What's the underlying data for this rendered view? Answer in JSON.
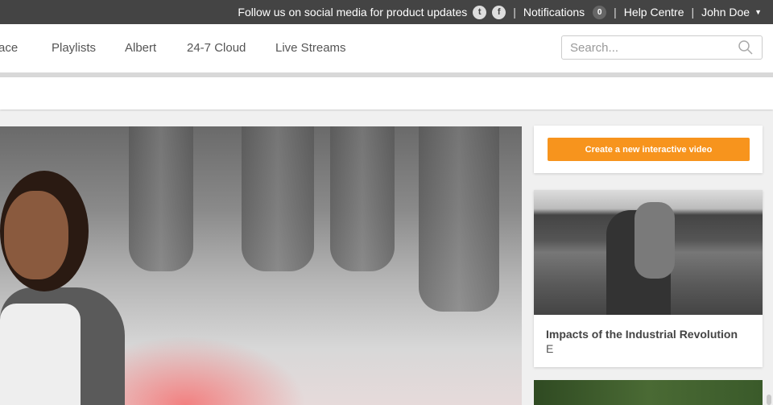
{
  "topbar": {
    "follow_text": "Follow us on social media for product updates",
    "twitter_icon": "twitter-icon",
    "facebook_icon": "facebook-icon",
    "notifications_label": "Notifications",
    "notifications_count": "0",
    "help_label": "Help Centre",
    "user_name": "John Doe",
    "separator": "|"
  },
  "nav": {
    "items": [
      {
        "label": "ace"
      },
      {
        "label": "Playlists"
      },
      {
        "label": "Albert"
      },
      {
        "label": "24-7 Cloud"
      },
      {
        "label": "Live Streams"
      }
    ],
    "search_placeholder": "Search..."
  },
  "sidebar": {
    "cta_label": "Create a new interactive video",
    "cta_color": "#f7941d",
    "cards": [
      {
        "title": "Impacts of the Industrial Revolution",
        "subtitle": "E"
      }
    ]
  }
}
